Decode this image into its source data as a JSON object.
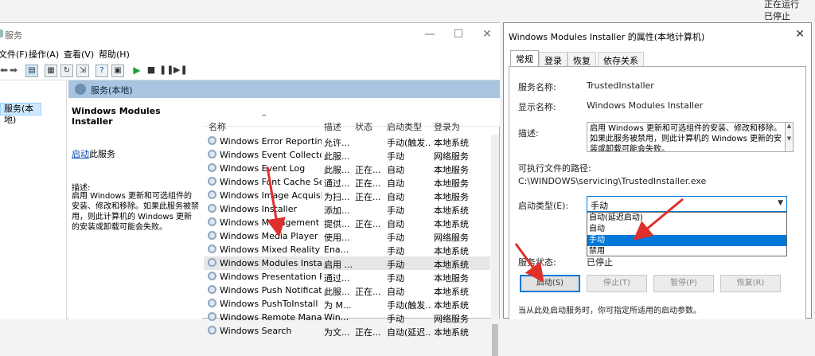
{
  "background": {
    "status_lines": [
      "正在运行",
      "已停止"
    ]
  },
  "main_window": {
    "title": "服务",
    "menu": [
      "文件(F)",
      "操作(A)",
      "查看(V)",
      "帮助(H)"
    ],
    "tree_selected": "服务(本地)",
    "header_label": "服务(本地)",
    "description_pane": {
      "title": "Windows Modules Installer",
      "start_link": "启动",
      "start_link_suffix": "此服务",
      "desc_label": "描述:",
      "desc_text": "启用 Windows 更新和可选组件的安装、修改和移除。如果此服务被禁用，则此计算机的 Windows 更新的安装或卸载可能会失败。"
    },
    "columns": [
      "名称",
      "描述",
      "状态",
      "启动类型",
      "登录为"
    ],
    "rows": [
      {
        "name": "Windows Error Reportin...",
        "desc": "允许...",
        "status": "",
        "type": "手动(触发...",
        "logon": "本地系统"
      },
      {
        "name": "Windows Event Collector",
        "desc": "此服...",
        "status": "",
        "type": "手动",
        "logon": "网络服务"
      },
      {
        "name": "Windows Event Log",
        "desc": "此服...",
        "status": "正在...",
        "type": "自动",
        "logon": "本地服务"
      },
      {
        "name": "Windows Font Cache Ser...",
        "desc": "通过...",
        "status": "正在...",
        "type": "自动",
        "logon": "本地服务"
      },
      {
        "name": "Windows Image Acquisiti...",
        "desc": "为扫...",
        "status": "正在...",
        "type": "自动",
        "logon": "本地服务"
      },
      {
        "name": "Windows Installer",
        "desc": "添加...",
        "status": "",
        "type": "手动",
        "logon": "本地系统"
      },
      {
        "name": "Windows Management I...",
        "desc": "提供...",
        "status": "正在...",
        "type": "自动",
        "logon": "本地系统"
      },
      {
        "name": "Windows Media Player N...",
        "desc": "使用...",
        "status": "",
        "type": "手动",
        "logon": "网络服务"
      },
      {
        "name": "Windows Mixed Reality ...",
        "desc": "Ena...",
        "status": "",
        "type": "手动",
        "logon": "本地系统"
      },
      {
        "name": "Windows Modules Install...",
        "desc": "启用 ...",
        "status": "",
        "type": "手动",
        "logon": "本地系统"
      },
      {
        "name": "Windows Presentation Fo...",
        "desc": "通过...",
        "status": "",
        "type": "手动",
        "logon": "本地服务"
      },
      {
        "name": "Windows Push Notificati...",
        "desc": "此服...",
        "status": "正在...",
        "type": "自动",
        "logon": "本地系统"
      },
      {
        "name": "Windows PushToInstall ...",
        "desc": "为 M...",
        "status": "",
        "type": "手动(触发...",
        "logon": "本地系统"
      },
      {
        "name": "Windows Remote Manag...",
        "desc": "Win...",
        "status": "",
        "type": "手动",
        "logon": "网络服务"
      },
      {
        "name": "Windows Search",
        "desc": "为文...",
        "status": "正在...",
        "type": "自动(延迟...",
        "logon": "本地系统"
      }
    ]
  },
  "dialog": {
    "title": "Windows Modules Installer 的属性(本地计算机)",
    "tabs": [
      "常规",
      "登录",
      "恢复",
      "依存关系"
    ],
    "service_name_label": "服务名称:",
    "service_name": "TrustedInstaller",
    "display_name_label": "显示名称:",
    "display_name": "Windows Modules Installer",
    "desc_label": "描述:",
    "desc_text": "启用 Windows 更新和可选组件的安装、修改和移除。如果此服务被禁用，则此计算机的 Windows 更新的安装或卸载可能会失败。",
    "exe_path_label": "可执行文件的路径:",
    "exe_path": "C:\\WINDOWS\\servicing\\TrustedInstaller.exe",
    "startup_type_label": "启动类型(E):",
    "startup_type_value": "手动",
    "startup_options": [
      "自动(延迟启动)",
      "自动",
      "手动",
      "禁用"
    ],
    "highlighted_option_index": 2,
    "service_status_label": "服务状态:",
    "service_status": "已停止",
    "buttons": {
      "start": "启动(S)",
      "stop": "停止(T)",
      "pause": "暂停(P)",
      "resume": "恢复(R)"
    },
    "footer_text": "当从此处启动服务时，你可指定所适用的启动参数。"
  },
  "colors": {
    "accent": "#0078d7",
    "annotation": "#e0302b",
    "header_band": "#a8c4e0"
  }
}
